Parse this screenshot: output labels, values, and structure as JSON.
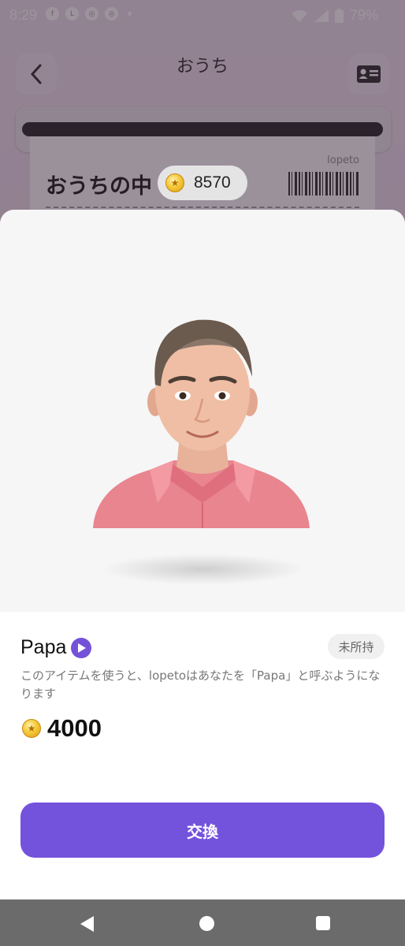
{
  "status_bar": {
    "time": "8:29",
    "battery": "79%",
    "icons": [
      "facebook-icon",
      "line-icon",
      "app-icon",
      "app-icon",
      "dot-icon",
      "wifi-icon",
      "signal-icon",
      "battery-icon"
    ]
  },
  "header": {
    "title": "おうち",
    "back_icon": "chevron-left-icon",
    "card_icon": "id-card-icon"
  },
  "background_ticket": {
    "title": "おうちの中",
    "brand": "lopeto",
    "coin_balance": "8570"
  },
  "item": {
    "name": "Papa",
    "ownership_badge": "未所持",
    "description": "このアイテムを使うと、lopetoはあなたを「Papa」と呼ぶようになります",
    "price": "4000",
    "exchange_label": "交換"
  },
  "colors": {
    "accent": "#7352dc",
    "shirt": "#e8858f"
  }
}
